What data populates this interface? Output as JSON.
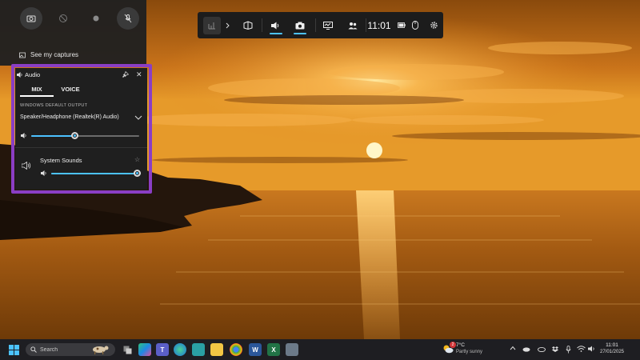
{
  "capture_widget": {
    "see_captures_label": "See my captures"
  },
  "audio_widget": {
    "title": "Audio",
    "tabs": [
      {
        "label": "MIX",
        "active": true
      },
      {
        "label": "VOICE",
        "active": false
      }
    ],
    "section_label": "WINDOWS DEFAULT OUTPUT",
    "output_device": "Speaker/Headphone (Realtek(R) Audio)",
    "master_volume": 0.4,
    "apps": [
      {
        "name": "System Sounds",
        "volume": 1.0
      }
    ]
  },
  "gamebar": {
    "time": "11:01"
  },
  "taskbar": {
    "search_placeholder": "Search",
    "weather_badge": "2",
    "weather_temp": "7°C",
    "weather_condition": "Partly sunny",
    "clock_time": "11:01",
    "clock_date": "27/01/2025"
  },
  "colors": {
    "accent": "#4cc2ff",
    "highlight_border": "#8a3ec4",
    "panel_bg": "#1f1f1f",
    "taskbar_bg": "#1e1e22"
  }
}
